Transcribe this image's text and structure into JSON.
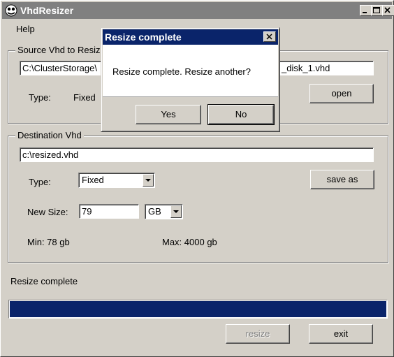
{
  "window": {
    "title": "VhdResizer",
    "title_buttons": [
      "minimize",
      "maximize",
      "close"
    ]
  },
  "menu": {
    "help": "Help"
  },
  "source": {
    "group_title": "Source Vhd to Resiz",
    "path_left": "C:\\ClusterStorage\\",
    "path_right": "_disk_1.vhd",
    "type_label": "Type:",
    "type_value": "Fixed",
    "open_button": "open"
  },
  "destination": {
    "group_title": "Destination Vhd",
    "path": "c:\\resized.vhd",
    "type_label": "Type:",
    "type_value": "Fixed",
    "save_as_button": "save as",
    "new_size_label": "New Size:",
    "new_size_value": "79",
    "unit_value": "GB",
    "min_text": "Min: 78 gb",
    "max_text": "Max: 4000 gb"
  },
  "status": {
    "text": "Resize complete",
    "progress_fraction": 1.0,
    "progress_color": "#0a246a"
  },
  "footer": {
    "resize_button": "resize",
    "exit_button": "exit"
  },
  "dialog": {
    "title": "Resize complete",
    "message": "Resize complete. Resize another?",
    "yes_button": "Yes",
    "no_button": "No"
  }
}
